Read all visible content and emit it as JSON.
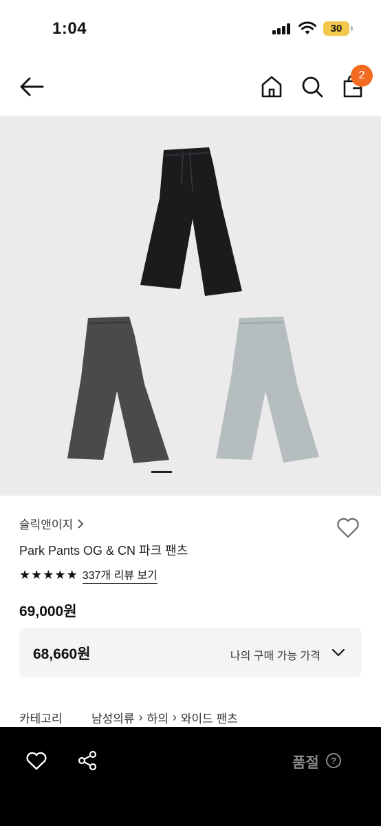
{
  "status_bar": {
    "time": "1:04",
    "battery": "30"
  },
  "nav": {
    "cart_count": "2"
  },
  "product": {
    "brand": "슬릭앤이지",
    "title": "Park Pants OG & CN 파크 팬츠",
    "review_link": "337개 리뷰 보기",
    "rating_stars": 5,
    "price": "69,000원",
    "my_price": "68,660원",
    "my_price_label": "나의 구매 가능 가격",
    "image_colors": [
      "#1b1b1e",
      "#4a4a4a",
      "#b6bdbf"
    ]
  },
  "category": {
    "label": "카테고리",
    "path": [
      "남성의류",
      "하의",
      "와이드 팬츠"
    ]
  },
  "bottom_bar": {
    "status": "품절"
  },
  "colors": {
    "accent": "#f26b21",
    "bottom_bar": "#000000"
  }
}
